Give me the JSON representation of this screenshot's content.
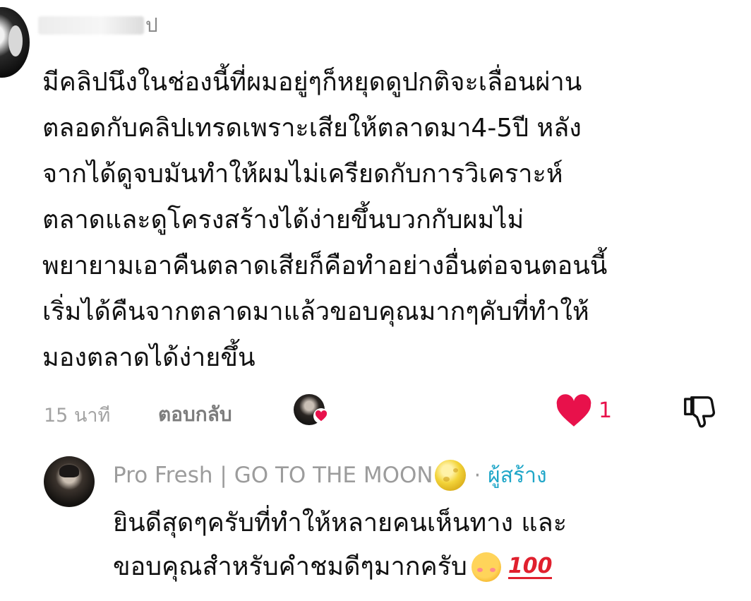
{
  "comment": {
    "username_visible": "ป",
    "text_lines": [
      "มีคลิปนึงในช่องนี้ที่ผมอยู่ๆก็หยุดดูปกติจะเลื่อนผ่าน",
      "ตลอดกับคลิปเทรดเพราะเสียให้ตลาดมา4-5ปี หลัง",
      "จากได้ดูจบมันทำให้ผมไม่เครียดกับการวิเคราะห์",
      "ตลาดและดูโครงสร้างได้ง่ายขึ้นบวกกับผมไม่",
      "พยายามเอาคืนตลาดเสียก็คือทำอย่างอื่นต่อจนตอนนี้",
      "เริ่มได้คืนจากตลาดมาแล้วขอบคุณมากๆคับที่ทำให้",
      "มองตลาดได้ง่ายขึ้น"
    ],
    "time": "15 นาที",
    "reply_label": "ตอบกลับ",
    "like_count": "1",
    "liked": true,
    "liked_by_creator": true,
    "icons": {
      "like": "heart-icon",
      "dislike": "thumbs-down-icon",
      "creator_heart": "creator-heart-icon"
    },
    "colors": {
      "like": "#e8114b",
      "time": "#a3a3a3"
    }
  },
  "reply": {
    "author": "Pro Fresh | GO TO THE MOON",
    "author_emoji": "full-moon-emoji",
    "separator": "·",
    "badge": "ผู้สร้าง",
    "text_lines": [
      "ยินดีสุดๆครับที่ทำให้หลายคนเห็นทาง และ",
      "ขอบคุณสำหรับคำชมดีๆมากครับ"
    ],
    "trailing_emojis": [
      "smiling-face-with-hearts-emoji",
      "hundred-points-emoji"
    ],
    "hundred_text": "100",
    "colors": {
      "badge": "#1fa6c8",
      "author": "#9c9c9c"
    }
  }
}
